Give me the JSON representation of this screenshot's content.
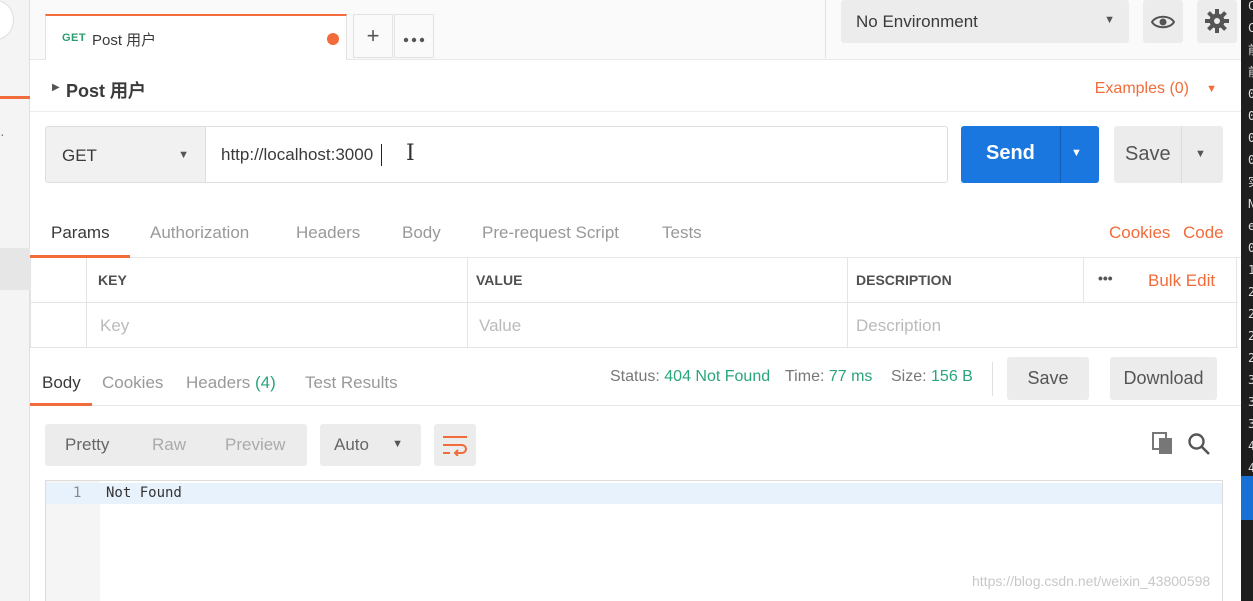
{
  "tab": {
    "method": "GET",
    "name": "Post 用户"
  },
  "environment": {
    "selected": "No Environment"
  },
  "request": {
    "title": "Post 用户",
    "examples": "Examples (0)",
    "method": "GET",
    "url": "http://localhost:3000",
    "send_label": "Send",
    "save_label": "Save"
  },
  "request_tabs": [
    "Params",
    "Authorization",
    "Headers",
    "Body",
    "Pre-request Script",
    "Tests"
  ],
  "request_links": {
    "cookies": "Cookies",
    "code": "Code"
  },
  "params": {
    "headers": [
      "KEY",
      "VALUE",
      "DESCRIPTION"
    ],
    "more": "•••",
    "bulk_edit": "Bulk Edit",
    "placeholders": [
      "Key",
      "Value",
      "Description"
    ]
  },
  "response": {
    "tabs": [
      "Body",
      "Cookies",
      "Headers",
      "Test Results"
    ],
    "headers_label": "Headers",
    "headers_count": "(4)",
    "status_label": "Status:",
    "status_value": "404 Not Found",
    "time_label": "Time:",
    "time_value": "77 ms",
    "size_label": "Size:",
    "size_value": "156 B",
    "save_label": "Save",
    "download_label": "Download"
  },
  "view": {
    "modes": [
      "Pretty",
      "Raw",
      "Preview"
    ],
    "format": "Auto"
  },
  "editor": {
    "line_number": "1",
    "content": "Not Found"
  },
  "right_strip_chars": [
    "C",
    "C",
    "前",
    "前",
    "0",
    "0",
    "0",
    "0",
    "实",
    "N",
    "e",
    "0",
    "1",
    "2",
    "2",
    "2",
    "2",
    "3",
    "3",
    "3",
    "4",
    "4"
  ],
  "watermark": "https://blog.csdn.net/weixin_43800598",
  "colors": {
    "accent": "#f26b3a",
    "send": "#1a77e0",
    "status_value": "#2aa57a",
    "method_get": "#2a9d6e"
  }
}
